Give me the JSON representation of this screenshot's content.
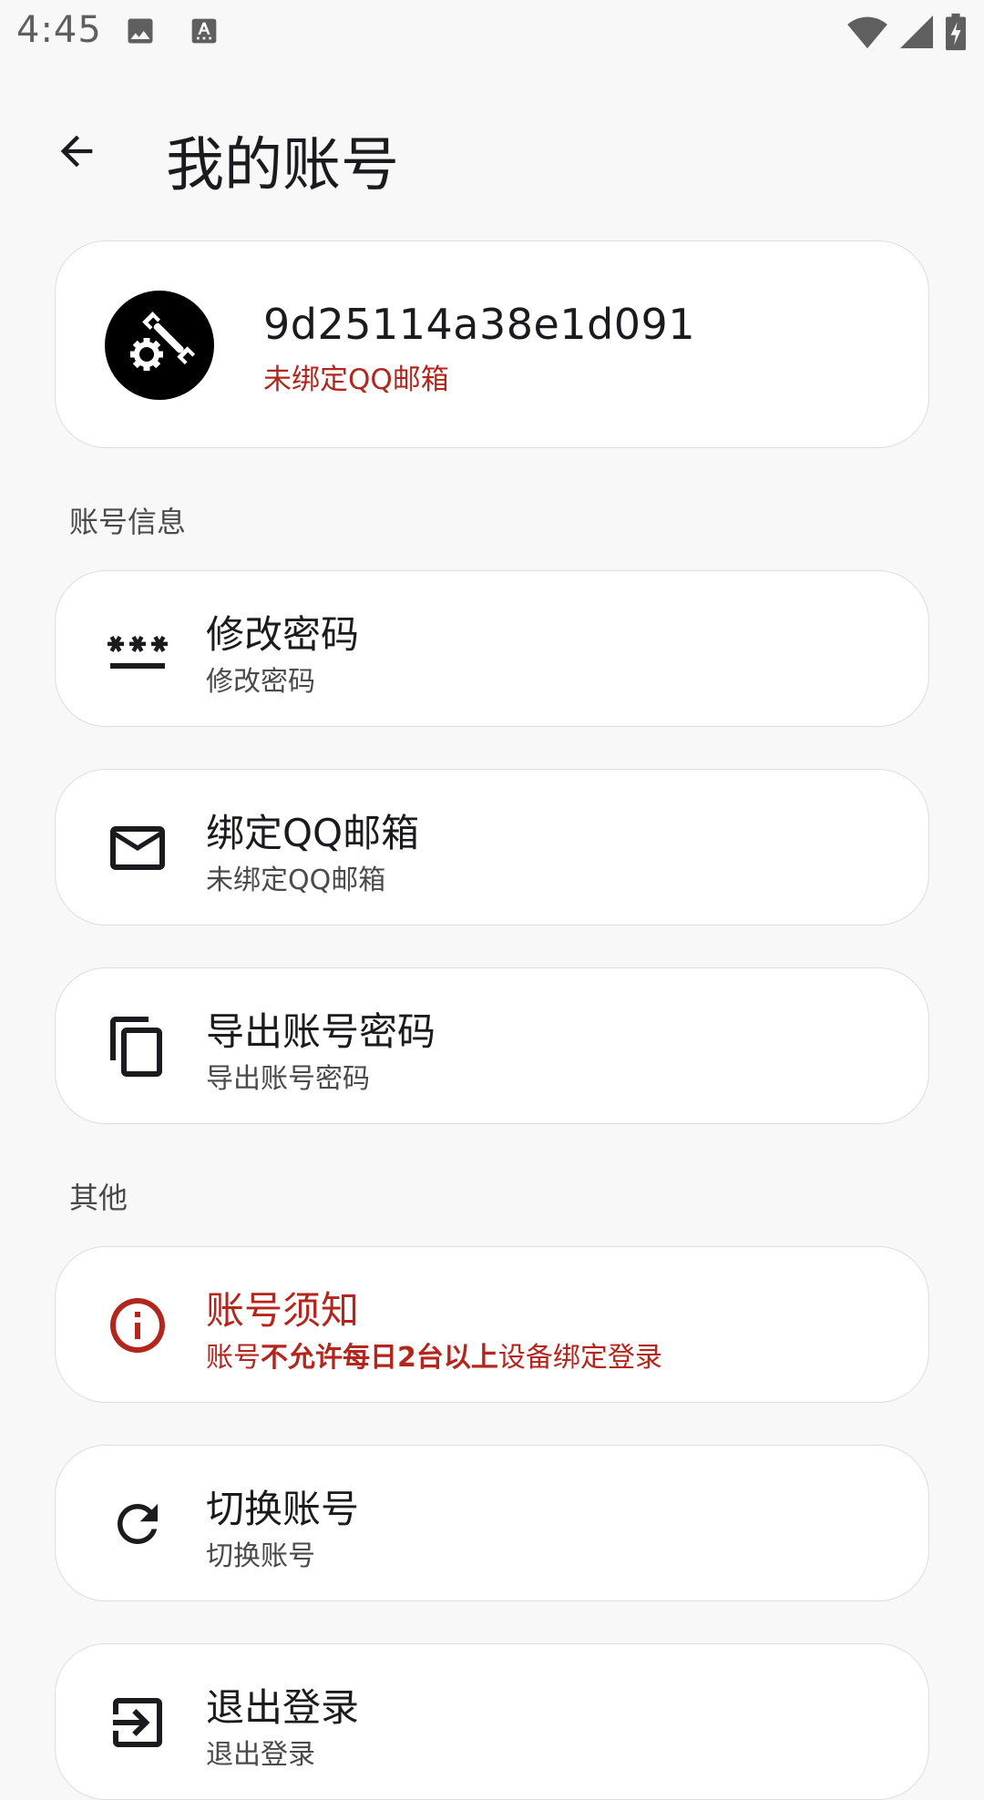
{
  "status_bar": {
    "time": "4:45",
    "left_icons": [
      "image-icon",
      "text-a-icon"
    ],
    "right_icons": [
      "wifi-icon",
      "signal-icon",
      "battery-charging-icon"
    ]
  },
  "app_bar": {
    "title": "我的账号",
    "back_icon": "arrow-back-icon"
  },
  "profile": {
    "user_id": "9d25114a38e1d091",
    "subtitle": "未绑定QQ邮箱",
    "avatar_icon": "wrench-gear-icon"
  },
  "sections": {
    "account_info": "账号信息",
    "other": "其他"
  },
  "items": {
    "change_password": {
      "title": "修改密码",
      "subtitle": "修改密码",
      "icon": "password-icon"
    },
    "bind_email": {
      "title": "绑定QQ邮箱",
      "subtitle": "未绑定QQ邮箱",
      "icon": "mail-icon"
    },
    "export": {
      "title": "导出账号密码",
      "subtitle": "导出账号密码",
      "icon": "copy-icon"
    },
    "notice": {
      "title": "账号须知",
      "subtitle_parts": [
        "账号",
        "不允许",
        "每日2台以上",
        "设备绑定登录"
      ],
      "icon": "info-icon"
    },
    "switch_account": {
      "title": "切换账号",
      "subtitle": "切换账号",
      "icon": "refresh-icon"
    },
    "logout": {
      "title": "退出登录",
      "subtitle": "退出登录",
      "icon": "logout-icon"
    }
  },
  "colors": {
    "background": "#f8f8f8",
    "card": "#ffffff",
    "accent_red": "#b3261e",
    "text_primary": "#1b1b1f",
    "text_secondary": "#4a4a4a"
  }
}
